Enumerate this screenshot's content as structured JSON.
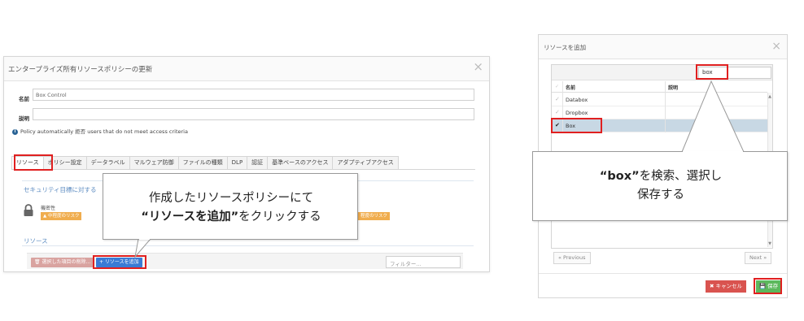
{
  "left_dialog": {
    "title": "エンタープライズ所有リソースポリシーの更新",
    "close": "×",
    "name_label": "名前",
    "name_value": "Box Control",
    "desc_label": "説明",
    "desc_value": "",
    "info_text": "Policy automatically 拒否 users that do not meet access criteria",
    "tabs": [
      "リソース",
      "ポリシー設定",
      "データラベル",
      "マルウェア防御",
      "ファイルの種類",
      "DLP",
      "認証",
      "基準ベースのアクセス",
      "アダプティブアクセス"
    ],
    "security_heading": "セキュリティ目標に対する",
    "confidential_label": "機密性",
    "risk_badge_left": "▲ 中程度のリスク",
    "risk_badge_right": "程度のリスク",
    "resource_heading": "リソース",
    "delete_button": "🗑 選択した項目の削除...",
    "add_resource_button": "+ リソースを追加",
    "filter_placeholder": "フィルター..."
  },
  "callout_left": {
    "line1": "作成したリソースポリシーにて",
    "line2_bold": "“リソースを追加”",
    "line2_rest": "をクリックする"
  },
  "right_dialog": {
    "title": "リソースを追加",
    "close": "×",
    "search_value": "box",
    "col_name": "名前",
    "col_desc": "説明",
    "rows": [
      {
        "name": "Databox",
        "selected": false
      },
      {
        "name": "Dropbox",
        "selected": false
      },
      {
        "name": "Box",
        "selected": true
      }
    ],
    "prev_button": "« Previous",
    "next_button": "Next »",
    "cancel_button": "✖ キャンセル",
    "save_button": "💾 保存"
  },
  "callout_right": {
    "line1_bold": "“box”",
    "line1_rest": "を検索、選択し",
    "line2": "保存する"
  },
  "colors": {
    "highlight": "#e02020",
    "add_button": "#3a7bd5",
    "risk_badge": "#f0ad4e",
    "cancel": "#d9534f",
    "save": "#5cb85c",
    "selected_row": "#c8d8e4"
  }
}
